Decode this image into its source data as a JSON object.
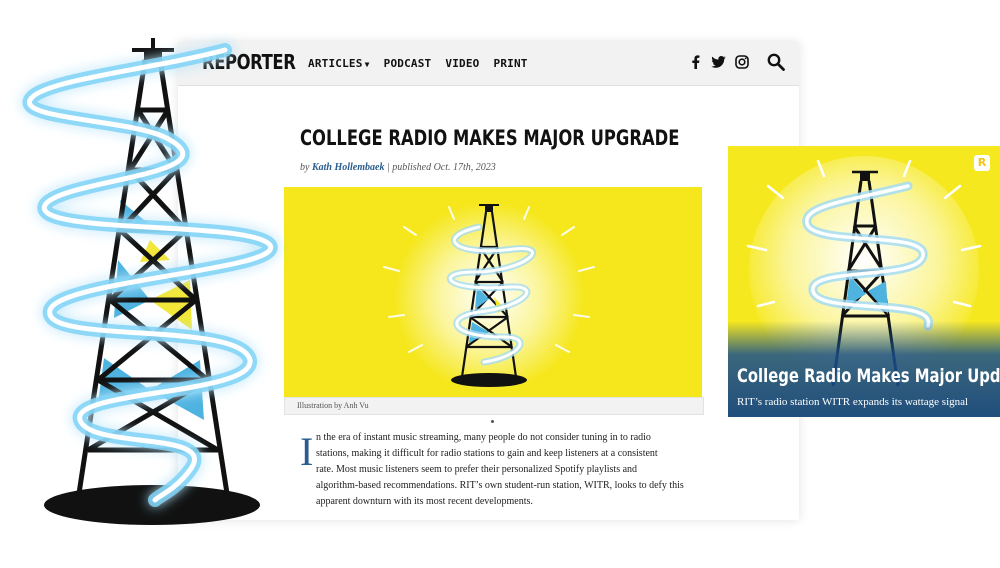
{
  "site": {
    "logo": "REPORTER",
    "nav": [
      {
        "label": "ARTICLES",
        "has_dropdown": true
      },
      {
        "label": "PODCAST"
      },
      {
        "label": "VIDEO"
      },
      {
        "label": "PRINT"
      }
    ],
    "social_icons": [
      "facebook-icon",
      "twitter-icon",
      "instagram-icon"
    ],
    "search_icon": "search-icon"
  },
  "article": {
    "headline": "COLLEGE RADIO MAKES MAJOR UPGRADE",
    "byline_prefix": "by",
    "author": "Kath Hollembaek",
    "separator": "|",
    "published": "published Oct. 17th, 2023",
    "caption": "Illustration by Anh Vu",
    "dropcap": "I",
    "body_lines": [
      "n the era of instant music streaming, many people do not consider tuning in to radio",
      "stations, making it difficult for radio stations to gain and keep listeners at a consistent",
      "rate. Most music listeners seem to prefer their personalized Spotify playlists and",
      "algorithm-based recommendations. RIT’s own student-run station, WITR, looks to defy this",
      "apparent downturn with its most recent developments."
    ]
  },
  "card": {
    "badge": "R",
    "title": "College Radio Makes Major Update",
    "subtitle": "RIT’s radio station WITR expands its wattage signal"
  },
  "colors": {
    "accent_yellow": "#f5e71c",
    "link_blue": "#2a5d8f",
    "glow_blue": "#4fc3f7",
    "card_blue": "#1e5a96"
  }
}
